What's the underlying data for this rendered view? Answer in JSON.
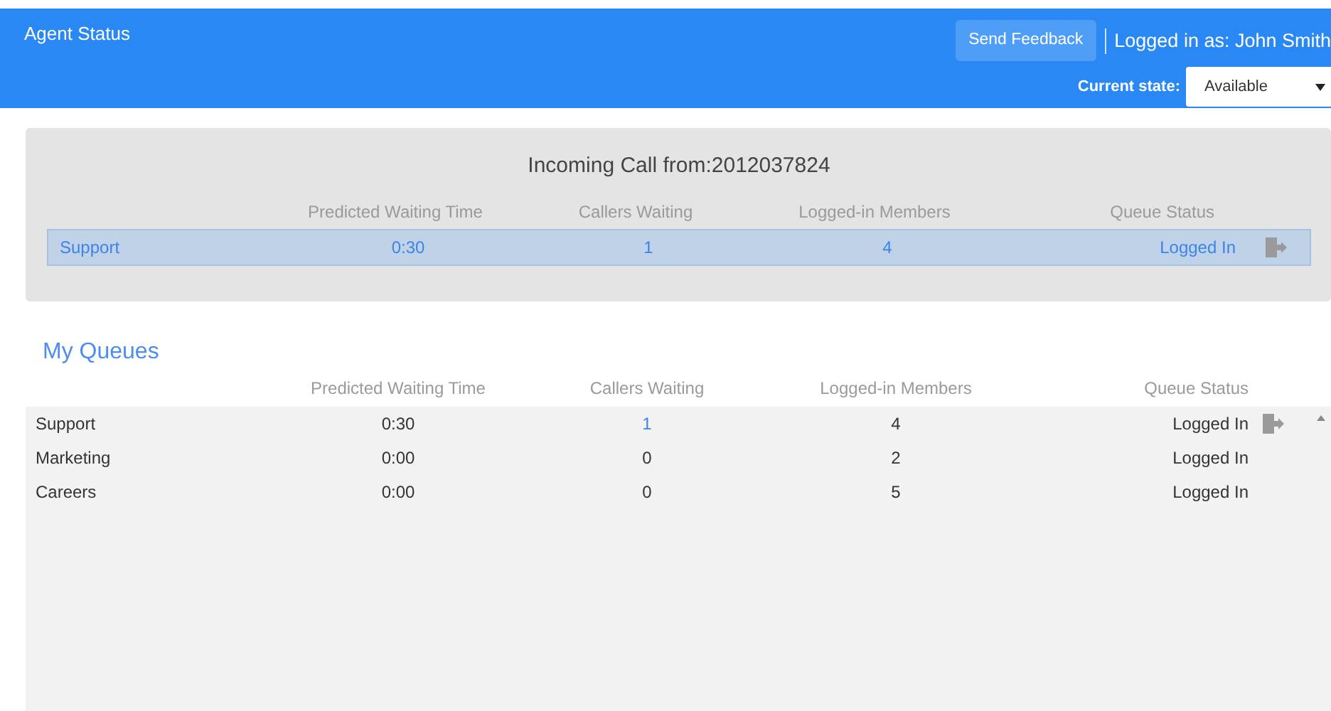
{
  "header": {
    "title": "Agent Status",
    "feedback_button": "Send Feedback",
    "logged_in": "Logged in as: John Smith",
    "state_label": "Current state:",
    "state_value": "Available"
  },
  "incoming": {
    "title": "Incoming Call from:2012037824",
    "columns": [
      "Predicted Waiting Time",
      "Callers Waiting",
      "Logged-in Members",
      "Queue Status"
    ],
    "rows": [
      {
        "name": "Support",
        "wait": "0:30",
        "callers": "1",
        "members": "4",
        "status": "Logged In",
        "logout": true,
        "selected": true
      }
    ]
  },
  "queues": {
    "title": "My Queues",
    "columns": [
      "Predicted Waiting Time",
      "Callers Waiting",
      "Logged-in Members",
      "Queue Status"
    ],
    "rows": [
      {
        "name": "Support",
        "wait": "0:30",
        "callers": "1",
        "callers_link": true,
        "members": "4",
        "status": "Logged In",
        "logout": true
      },
      {
        "name": "Marketing",
        "wait": "0:00",
        "callers": "0",
        "callers_link": false,
        "members": "2",
        "status": "Logged In",
        "logout": false
      },
      {
        "name": "Careers",
        "wait": "0:00",
        "callers": "0",
        "callers_link": false,
        "members": "5",
        "status": "Logged In",
        "logout": false
      }
    ]
  }
}
